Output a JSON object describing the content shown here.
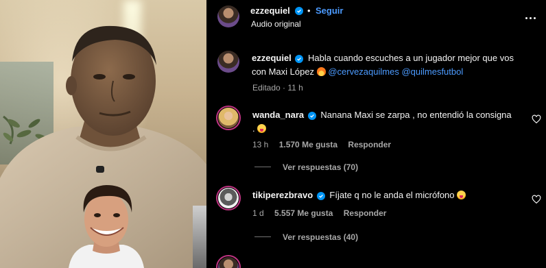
{
  "post": {
    "author": "ezzequiel",
    "dot": "•",
    "follow_label": "Seguir",
    "audio": "Audio original"
  },
  "caption": {
    "author": "ezzequiel",
    "text": "Habla cuando escuches a un jugador mejor que vos",
    "line2": "con Maxi López",
    "tag1": "@cervezaquilmes",
    "tag2": "@quilmesfutbol",
    "meta": "Editado · 11 h"
  },
  "comments": [
    {
      "author": "wanda_nara",
      "text_line1": "Nanana Maxi se zarpa , no entendió la consigna",
      "text_line2": ".",
      "time": "13 h",
      "likes": "1.570 Me gusta",
      "reply_label": "Responder",
      "view_replies": "Ver respuestas (70)"
    },
    {
      "author": "tikiperezbravo",
      "text_line1": "Fíjate q no le anda el micrófono",
      "time": "1 d",
      "likes": "5.557 Me gusta",
      "reply_label": "Responder",
      "view_replies": "Ver respuestas (40)"
    }
  ],
  "icons": {
    "verified": "verified-badge-icon",
    "more": "more-options-icon",
    "heart": "heart-icon"
  },
  "colors": {
    "background": "#000000",
    "link": "#4c9bff",
    "secondary_text": "#a8a8a8",
    "verified": "#0095f6"
  }
}
